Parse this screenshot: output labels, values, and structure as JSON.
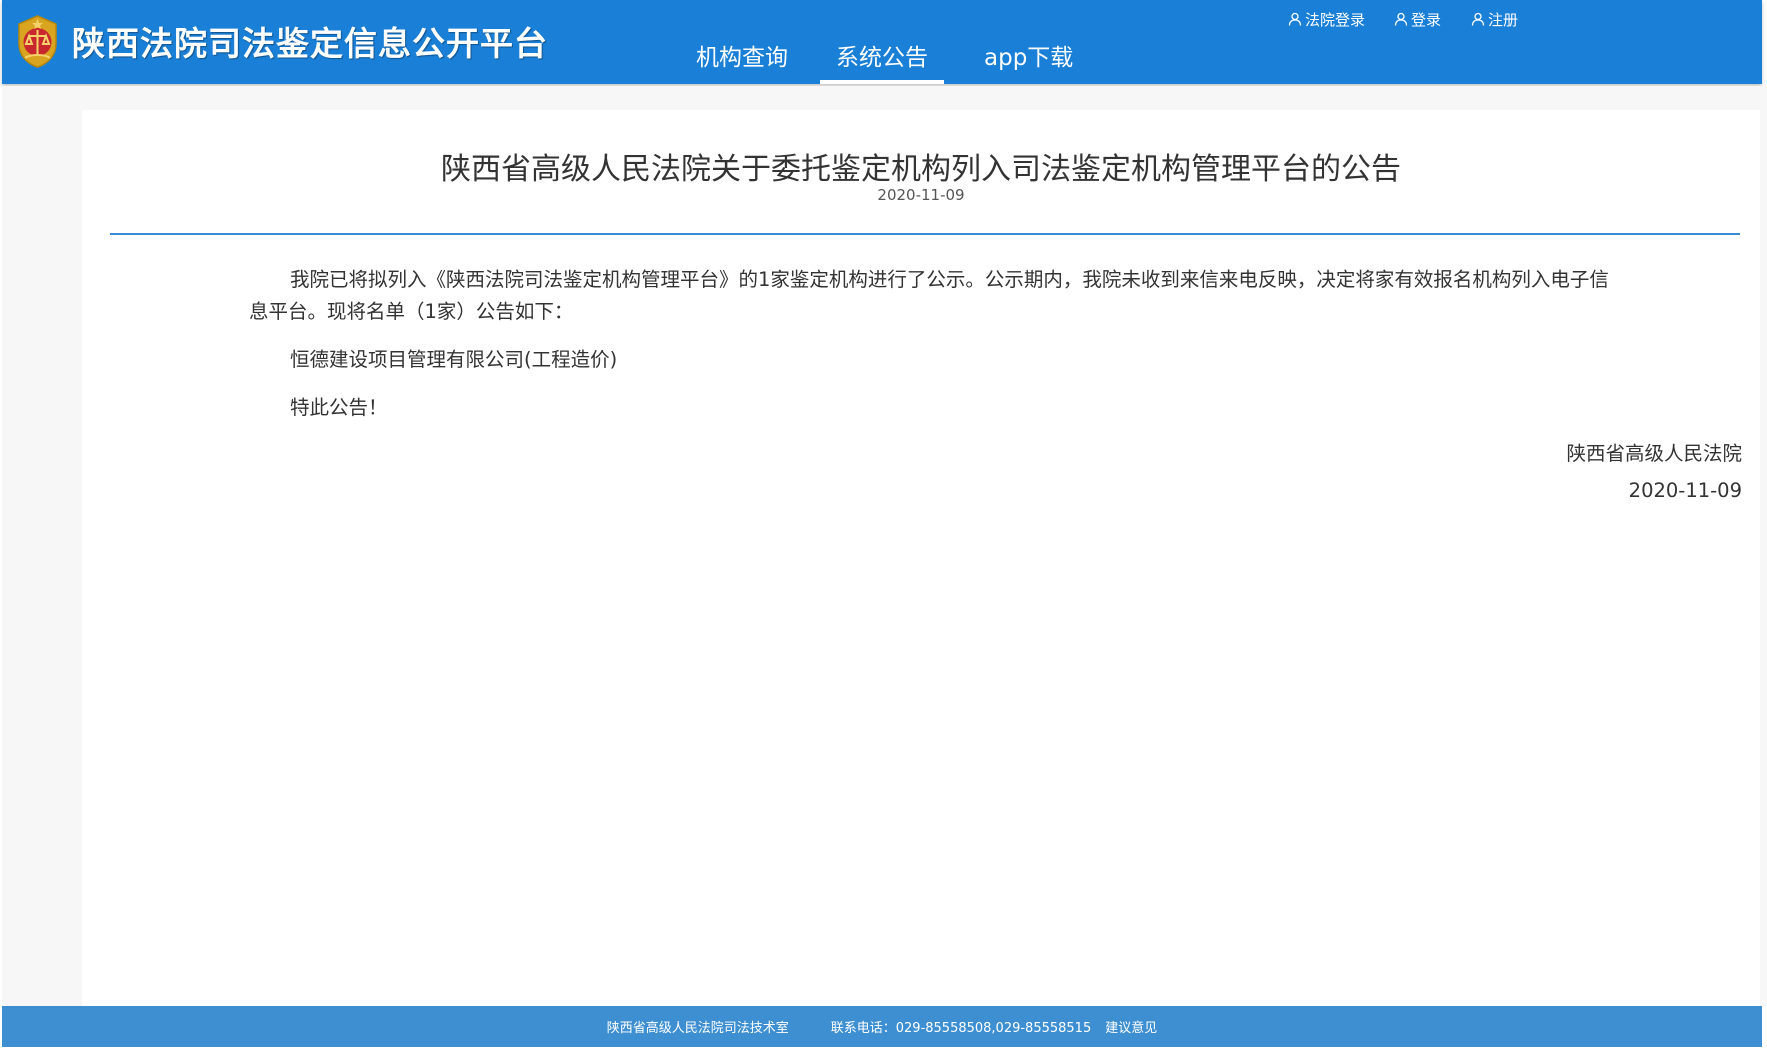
{
  "header": {
    "site_title": "陕西法院司法鉴定信息公开平台",
    "nav": [
      {
        "label": "机构查询",
        "active": false
      },
      {
        "label": "系统公告",
        "active": true
      },
      {
        "label": "app下载",
        "active": false
      }
    ],
    "user_links": [
      {
        "label": "法院登录",
        "icon": "user-icon"
      },
      {
        "label": "登录",
        "icon": "user-icon"
      },
      {
        "label": "注册",
        "icon": "user-icon"
      }
    ]
  },
  "notice": {
    "title": "陕西省高级人民法院关于委托鉴定机构列入司法鉴定机构管理平台的公告",
    "date": "2020-11-09",
    "paragraph_1": "我院已将拟列入《陕西法院司法鉴定机构管理平台》的1家鉴定机构进行了公示。公示期内，我院未收到来信来电反映，决定将家有效报名机构列入电子信息平台。现将名单（1家）公告如下：",
    "institution": "恒德建设项目管理有限公司(工程造价)",
    "closing": "特此公告！",
    "signature_org": "陕西省高级人民法院",
    "signature_date": "2020-11-09"
  },
  "footer": {
    "org": "陕西省高级人民法院司法技术室",
    "phone": "联系电话：029-85558508,029-85558515",
    "suggest": "建议意见"
  },
  "colors": {
    "header_bg": "#1a7fd6",
    "footer_bg": "#3d8fd2",
    "divider": "#3a88d8",
    "text": "#333333"
  }
}
